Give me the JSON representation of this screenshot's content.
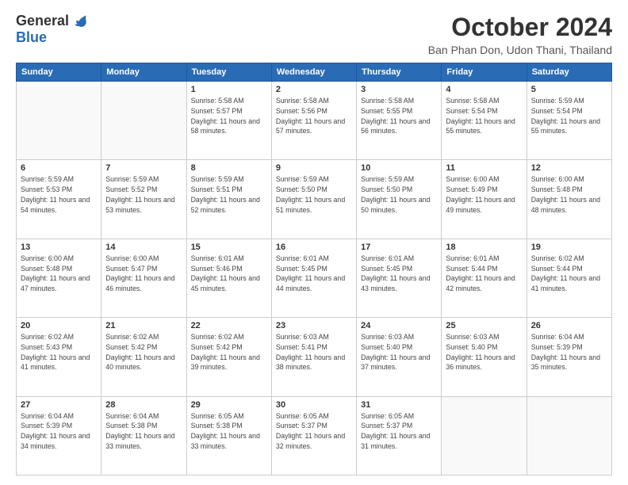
{
  "header": {
    "logo_general": "General",
    "logo_blue": "Blue",
    "title": "October 2024",
    "location": "Ban Phan Don, Udon Thani, Thailand"
  },
  "weekdays": [
    "Sunday",
    "Monday",
    "Tuesday",
    "Wednesday",
    "Thursday",
    "Friday",
    "Saturday"
  ],
  "weeks": [
    [
      {
        "day": "",
        "info": ""
      },
      {
        "day": "",
        "info": ""
      },
      {
        "day": "1",
        "info": "Sunrise: 5:58 AM\nSunset: 5:57 PM\nDaylight: 11 hours and 58 minutes."
      },
      {
        "day": "2",
        "info": "Sunrise: 5:58 AM\nSunset: 5:56 PM\nDaylight: 11 hours and 57 minutes."
      },
      {
        "day": "3",
        "info": "Sunrise: 5:58 AM\nSunset: 5:55 PM\nDaylight: 11 hours and 56 minutes."
      },
      {
        "day": "4",
        "info": "Sunrise: 5:58 AM\nSunset: 5:54 PM\nDaylight: 11 hours and 55 minutes."
      },
      {
        "day": "5",
        "info": "Sunrise: 5:59 AM\nSunset: 5:54 PM\nDaylight: 11 hours and 55 minutes."
      }
    ],
    [
      {
        "day": "6",
        "info": "Sunrise: 5:59 AM\nSunset: 5:53 PM\nDaylight: 11 hours and 54 minutes."
      },
      {
        "day": "7",
        "info": "Sunrise: 5:59 AM\nSunset: 5:52 PM\nDaylight: 11 hours and 53 minutes."
      },
      {
        "day": "8",
        "info": "Sunrise: 5:59 AM\nSunset: 5:51 PM\nDaylight: 11 hours and 52 minutes."
      },
      {
        "day": "9",
        "info": "Sunrise: 5:59 AM\nSunset: 5:50 PM\nDaylight: 11 hours and 51 minutes."
      },
      {
        "day": "10",
        "info": "Sunrise: 5:59 AM\nSunset: 5:50 PM\nDaylight: 11 hours and 50 minutes."
      },
      {
        "day": "11",
        "info": "Sunrise: 6:00 AM\nSunset: 5:49 PM\nDaylight: 11 hours and 49 minutes."
      },
      {
        "day": "12",
        "info": "Sunrise: 6:00 AM\nSunset: 5:48 PM\nDaylight: 11 hours and 48 minutes."
      }
    ],
    [
      {
        "day": "13",
        "info": "Sunrise: 6:00 AM\nSunset: 5:48 PM\nDaylight: 11 hours and 47 minutes."
      },
      {
        "day": "14",
        "info": "Sunrise: 6:00 AM\nSunset: 5:47 PM\nDaylight: 11 hours and 46 minutes."
      },
      {
        "day": "15",
        "info": "Sunrise: 6:01 AM\nSunset: 5:46 PM\nDaylight: 11 hours and 45 minutes."
      },
      {
        "day": "16",
        "info": "Sunrise: 6:01 AM\nSunset: 5:45 PM\nDaylight: 11 hours and 44 minutes."
      },
      {
        "day": "17",
        "info": "Sunrise: 6:01 AM\nSunset: 5:45 PM\nDaylight: 11 hours and 43 minutes."
      },
      {
        "day": "18",
        "info": "Sunrise: 6:01 AM\nSunset: 5:44 PM\nDaylight: 11 hours and 42 minutes."
      },
      {
        "day": "19",
        "info": "Sunrise: 6:02 AM\nSunset: 5:44 PM\nDaylight: 11 hours and 41 minutes."
      }
    ],
    [
      {
        "day": "20",
        "info": "Sunrise: 6:02 AM\nSunset: 5:43 PM\nDaylight: 11 hours and 41 minutes."
      },
      {
        "day": "21",
        "info": "Sunrise: 6:02 AM\nSunset: 5:42 PM\nDaylight: 11 hours and 40 minutes."
      },
      {
        "day": "22",
        "info": "Sunrise: 6:02 AM\nSunset: 5:42 PM\nDaylight: 11 hours and 39 minutes."
      },
      {
        "day": "23",
        "info": "Sunrise: 6:03 AM\nSunset: 5:41 PM\nDaylight: 11 hours and 38 minutes."
      },
      {
        "day": "24",
        "info": "Sunrise: 6:03 AM\nSunset: 5:40 PM\nDaylight: 11 hours and 37 minutes."
      },
      {
        "day": "25",
        "info": "Sunrise: 6:03 AM\nSunset: 5:40 PM\nDaylight: 11 hours and 36 minutes."
      },
      {
        "day": "26",
        "info": "Sunrise: 6:04 AM\nSunset: 5:39 PM\nDaylight: 11 hours and 35 minutes."
      }
    ],
    [
      {
        "day": "27",
        "info": "Sunrise: 6:04 AM\nSunset: 5:39 PM\nDaylight: 11 hours and 34 minutes."
      },
      {
        "day": "28",
        "info": "Sunrise: 6:04 AM\nSunset: 5:38 PM\nDaylight: 11 hours and 33 minutes."
      },
      {
        "day": "29",
        "info": "Sunrise: 6:05 AM\nSunset: 5:38 PM\nDaylight: 11 hours and 33 minutes."
      },
      {
        "day": "30",
        "info": "Sunrise: 6:05 AM\nSunset: 5:37 PM\nDaylight: 11 hours and 32 minutes."
      },
      {
        "day": "31",
        "info": "Sunrise: 6:05 AM\nSunset: 5:37 PM\nDaylight: 11 hours and 31 minutes."
      },
      {
        "day": "",
        "info": ""
      },
      {
        "day": "",
        "info": ""
      }
    ]
  ]
}
